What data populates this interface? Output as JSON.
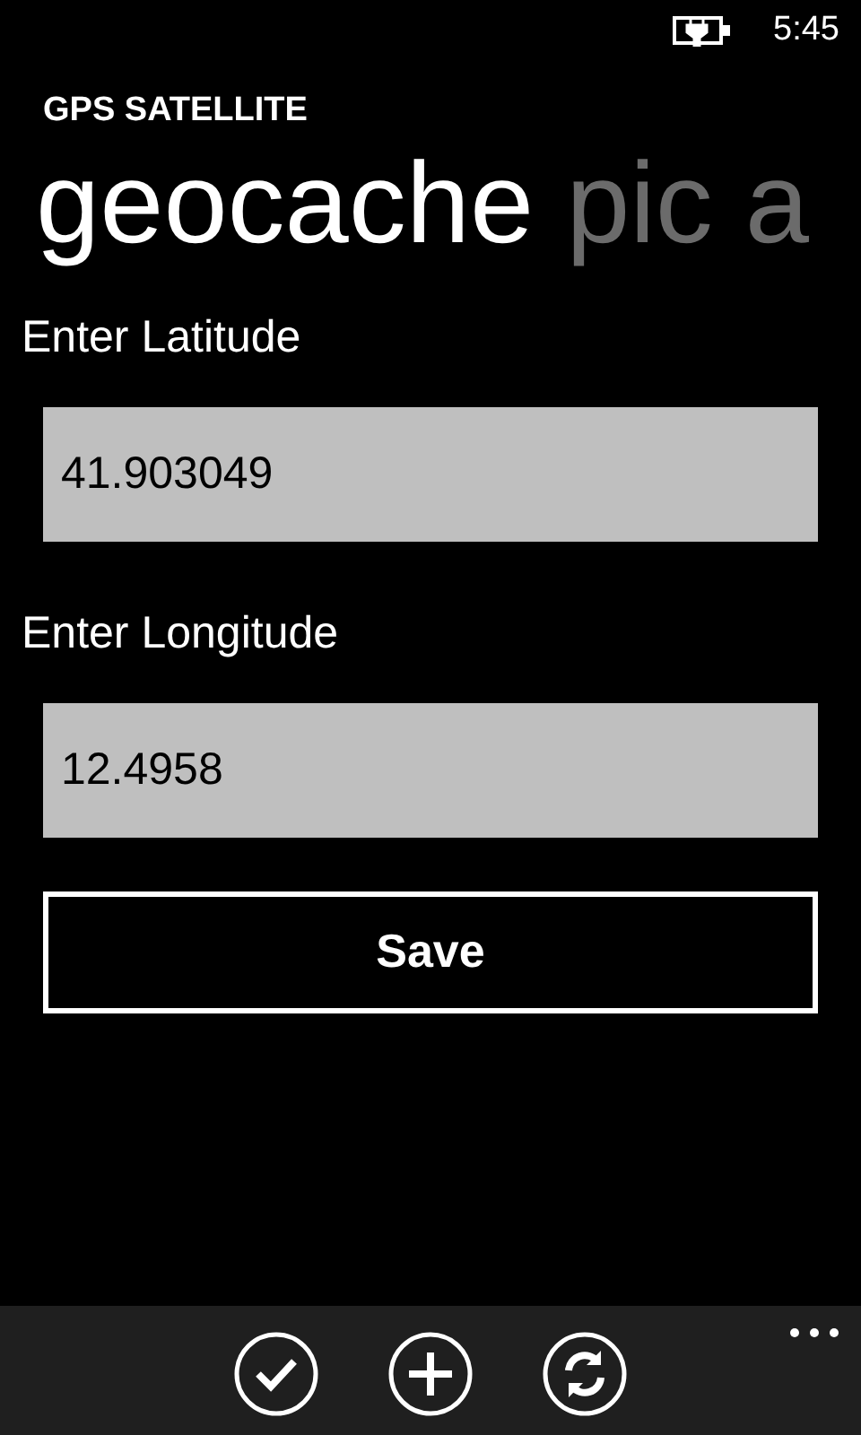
{
  "status_bar": {
    "time": "5:45"
  },
  "app_title": "GPS SATELLITE",
  "pivots": [
    {
      "label": "geocache",
      "selected": true
    },
    {
      "label": "pic",
      "selected": false
    },
    {
      "label": "a",
      "selected": false
    }
  ],
  "form": {
    "fields": [
      {
        "label": "Enter Latitude",
        "value": "41.903049"
      },
      {
        "label": "Enter Longitude",
        "value": "12.4958"
      }
    ],
    "save_button": "Save"
  },
  "app_bar": {
    "buttons": [
      {
        "kind": "check"
      },
      {
        "kind": "add"
      },
      {
        "kind": "refresh"
      }
    ]
  }
}
